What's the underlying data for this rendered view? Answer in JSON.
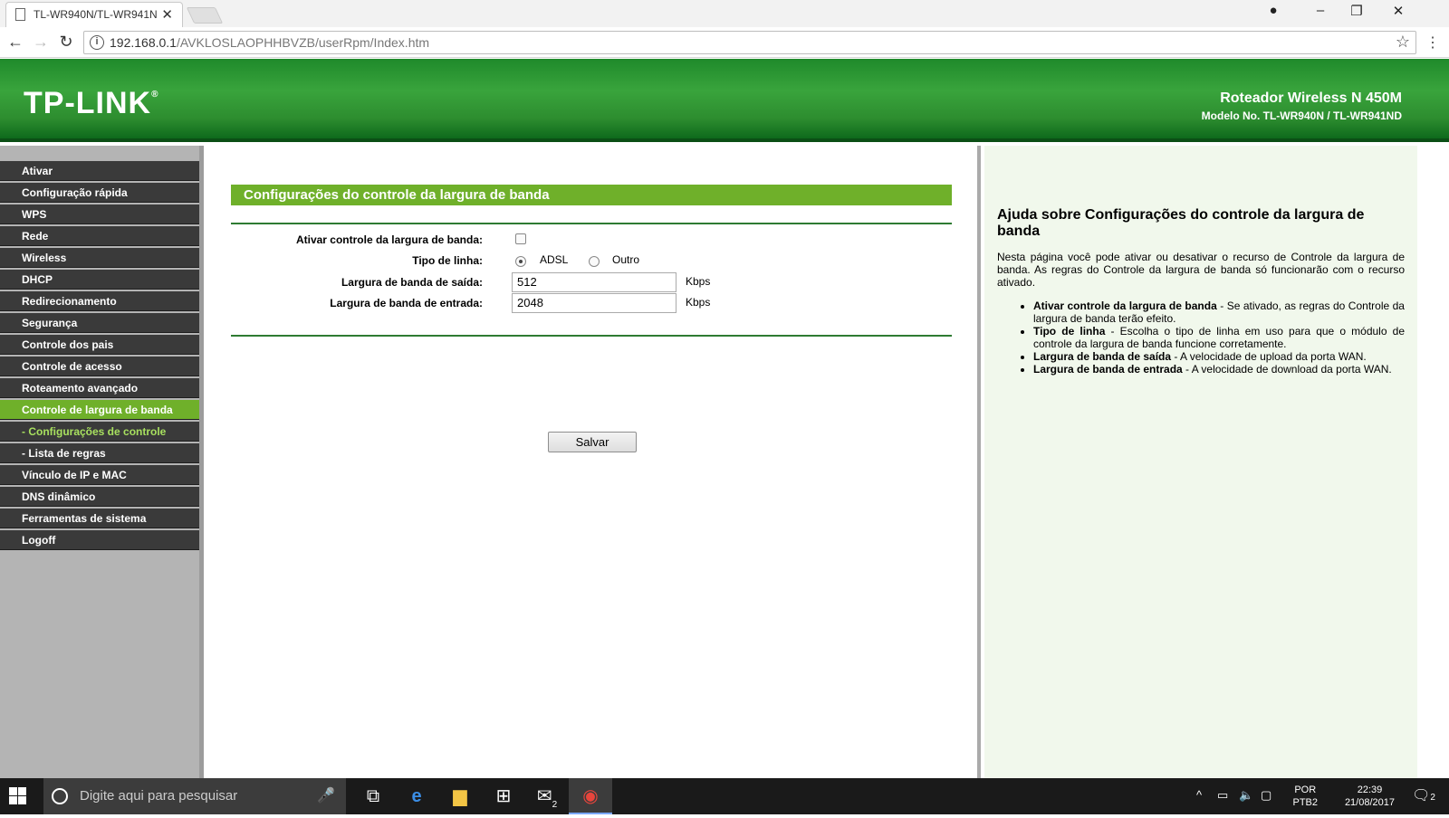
{
  "browser": {
    "tab_title": "TL-WR940N/TL-WR941N",
    "url_host": "192.168.0.1",
    "url_path": "/AVKLOSLAOPHHBVZB/userRpm/Index.htm"
  },
  "header": {
    "logo": "TP-LINK",
    "model_line1": "Roteador Wireless N 450M",
    "model_line2": "Modelo No. TL-WR940N / TL-WR941ND"
  },
  "sidebar": {
    "items": [
      {
        "label": "Ativar"
      },
      {
        "label": "Configuração rápida"
      },
      {
        "label": "WPS"
      },
      {
        "label": "Rede"
      },
      {
        "label": "Wireless"
      },
      {
        "label": "DHCP"
      },
      {
        "label": "Redirecionamento"
      },
      {
        "label": "Segurança"
      },
      {
        "label": "Controle dos pais"
      },
      {
        "label": "Controle de acesso"
      },
      {
        "label": "Roteamento avançado"
      },
      {
        "label": "Controle de largura de banda"
      },
      {
        "label": "- Configurações de controle"
      },
      {
        "label": "- Lista de regras"
      },
      {
        "label": "Vínculo de IP e MAC"
      },
      {
        "label": "DNS dinâmico"
      },
      {
        "label": "Ferramentas de sistema"
      },
      {
        "label": "Logoff"
      }
    ]
  },
  "main": {
    "title": "Configurações do controle da largura de banda",
    "enable_label": "Ativar controle da largura de banda:",
    "line_type_label": "Tipo de linha:",
    "line_type_options": [
      "ADSL",
      "Outro"
    ],
    "line_type_selected": "ADSL",
    "egress_label": "Largura de banda de saída:",
    "egress_value": "512",
    "ingress_label": "Largura de banda de entrada:",
    "ingress_value": "2048",
    "unit": "Kbps",
    "save_label": "Salvar"
  },
  "help": {
    "title": "Ajuda sobre Configurações do controle da largura de banda",
    "intro": "Nesta página você pode ativar ou desativar o recurso de Controle da largura de banda. As regras do Controle da largura de banda só funcionarão com o recurso ativado.",
    "items": [
      {
        "term": "Ativar controle da largura de banda",
        "desc": " - Se ativado, as regras do Controle da largura de banda terão efeito."
      },
      {
        "term": "Tipo de linha",
        "desc": " - Escolha o tipo de linha em uso para que o módulo de controle da largura de banda funcione corretamente."
      },
      {
        "term": "Largura de banda de saída",
        "desc": " - A velocidade de upload da porta WAN."
      },
      {
        "term": "Largura de banda de entrada",
        "desc": " - A velocidade de download da porta WAN."
      }
    ]
  },
  "taskbar": {
    "search_placeholder": "Digite aqui para pesquisar",
    "lang1": "POR",
    "lang2": "PTB2",
    "time": "22:39",
    "date": "21/08/2017",
    "mail_badge": "2",
    "notif_badge": "2"
  }
}
